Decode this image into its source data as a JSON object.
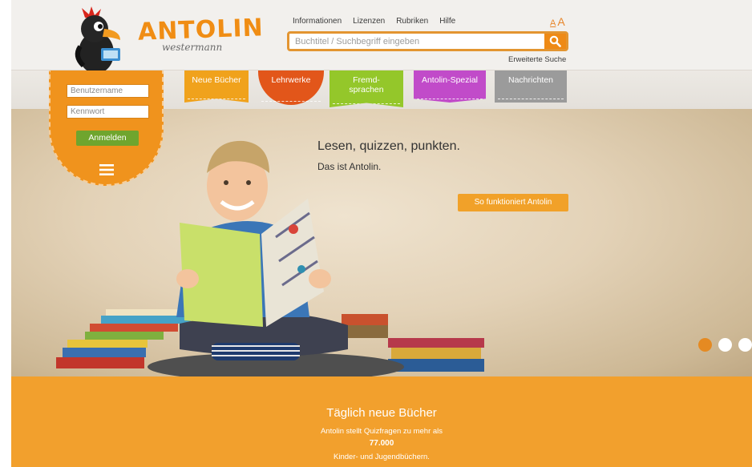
{
  "header": {
    "logo_text": "ANTOLIN",
    "logo_sub": "westermann",
    "nav": [
      "Informationen",
      "Lizenzen",
      "Rubriken",
      "Hilfe"
    ],
    "font_small": "A",
    "font_large": "A",
    "search_placeholder": "Buchtitel / Suchbegriff eingeben",
    "advanced_search": "Erweiterte Suche"
  },
  "categories": [
    {
      "label": "Neue Bücher",
      "color": "#f0a21c"
    },
    {
      "label": "Lehrwerke",
      "color": "#e2561a"
    },
    {
      "label_line1": "Fremd-",
      "label_line2": "sprachen",
      "color": "#94c72a"
    },
    {
      "label": "Antolin-Spezial",
      "color": "#c14bc9"
    },
    {
      "label": "Nachrichten",
      "color": "#9b9b9b"
    }
  ],
  "login": {
    "username_placeholder": "Benutzername",
    "password_placeholder": "Kennwort",
    "submit": "Anmelden",
    "menu_icon": "hamburger-icon"
  },
  "hero": {
    "title": "Lesen, quizzen, punkten.",
    "subtitle": "Das ist Antolin.",
    "cta": "So funktioniert Antolin",
    "slide_dots": 3,
    "active_slide": 1
  },
  "info": {
    "title": "Täglich neue Bücher",
    "line1": "Antolin stellt Quizfragen zu mehr als",
    "count": "77.000",
    "line3": "Kinder- und Jugendbüchern."
  },
  "colors": {
    "accent": "#f08d14",
    "login_button": "#6fa52e",
    "bottom_band": "#f2a02d"
  }
}
